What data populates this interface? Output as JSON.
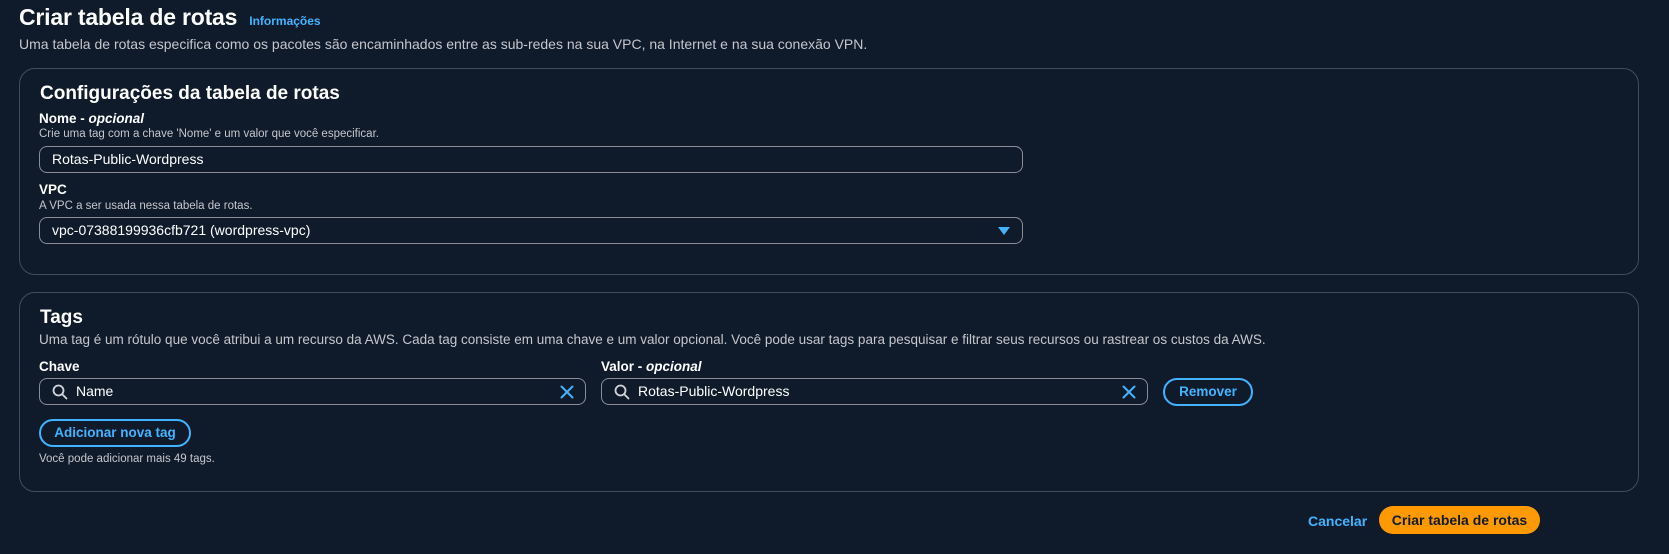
{
  "header": {
    "title": "Criar tabela de rotas",
    "info_link": "Informações",
    "description": "Uma tabela de rotas especifica como os pacotes são encaminhados entre as sub-redes na sua VPC, na Internet e na sua conexão VPN."
  },
  "settings": {
    "title": "Configurações da tabela de rotas",
    "name_label": "Nome - ",
    "name_optional": "opcional",
    "name_hint": "Crie uma tag com a chave 'Nome' e um valor que você especificar.",
    "name_value": "Rotas-Public-Wordpress",
    "vpc_label": "VPC",
    "vpc_hint": "A VPC a ser usada nessa tabela de rotas.",
    "vpc_value": "vpc-07388199936cfb721 (wordpress-vpc)"
  },
  "tags": {
    "title": "Tags",
    "description": "Uma tag é um rótulo que você atribui a um recurso da AWS. Cada tag consiste em uma chave e um valor opcional. Você pode usar tags para pesquisar e filtrar seus recursos ou rastrear os custos da AWS.",
    "key_label": "Chave",
    "value_label": "Valor - ",
    "value_optional": "opcional",
    "key_value": "Name",
    "value_value": "Rotas-Public-Wordpress",
    "remove_label": "Remover",
    "add_label": "Adicionar nova tag",
    "remaining_hint": "Você pode adicionar mais 49 tags."
  },
  "footer": {
    "cancel_label": "Cancelar",
    "submit_label": "Criar tabela de rotas"
  },
  "colors": {
    "background": "#0f1b2a",
    "accent": "#42b4ff",
    "primary_button": "#ff9900",
    "border": "#414d5c"
  },
  "icons": [
    "search-icon",
    "close-icon",
    "caret-down-icon"
  ]
}
